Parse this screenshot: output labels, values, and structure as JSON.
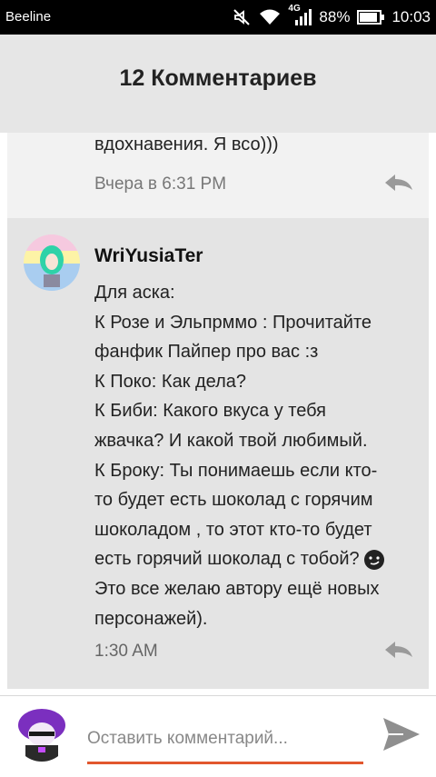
{
  "status_bar": {
    "carrier": "Beeline",
    "network": "4G",
    "battery": "88%",
    "time": "10:03",
    "icons": [
      "mute-icon",
      "wifi-icon",
      "signal-icon",
      "battery-icon"
    ]
  },
  "header": {
    "title": "12 Комментариев"
  },
  "comments": [
    {
      "text_tail": "вдохнавения. Я всо)))",
      "time": "Вчера в 6:31 PM"
    },
    {
      "author": "WriYusiaTer",
      "lines": [
        "Для аска:",
        "К Розе и Эльпрммо : Прочитайте",
        "фанфик Пайпер про вас :з",
        "К Поко: Как дела?",
        "К Биби: Какого вкуса у тебя",
        "жвачка? И какой твой любимый.",
        "К Броку: Ты понимаешь если кто-",
        "то будет есть шоколад с горячим",
        "шоколадом , то этот кто-то будет",
        "есть горячий шоколад с тобой?",
        "Это все желаю автору ещё новых",
        "персонажей)."
      ],
      "time": "1:30 AM"
    }
  ],
  "footer": {
    "input_placeholder": "Оставить комментарий..."
  },
  "colors": {
    "accent": "#e2572e",
    "header_bg": "#e6e6e6",
    "comment_bg": "#e4e4e4"
  }
}
